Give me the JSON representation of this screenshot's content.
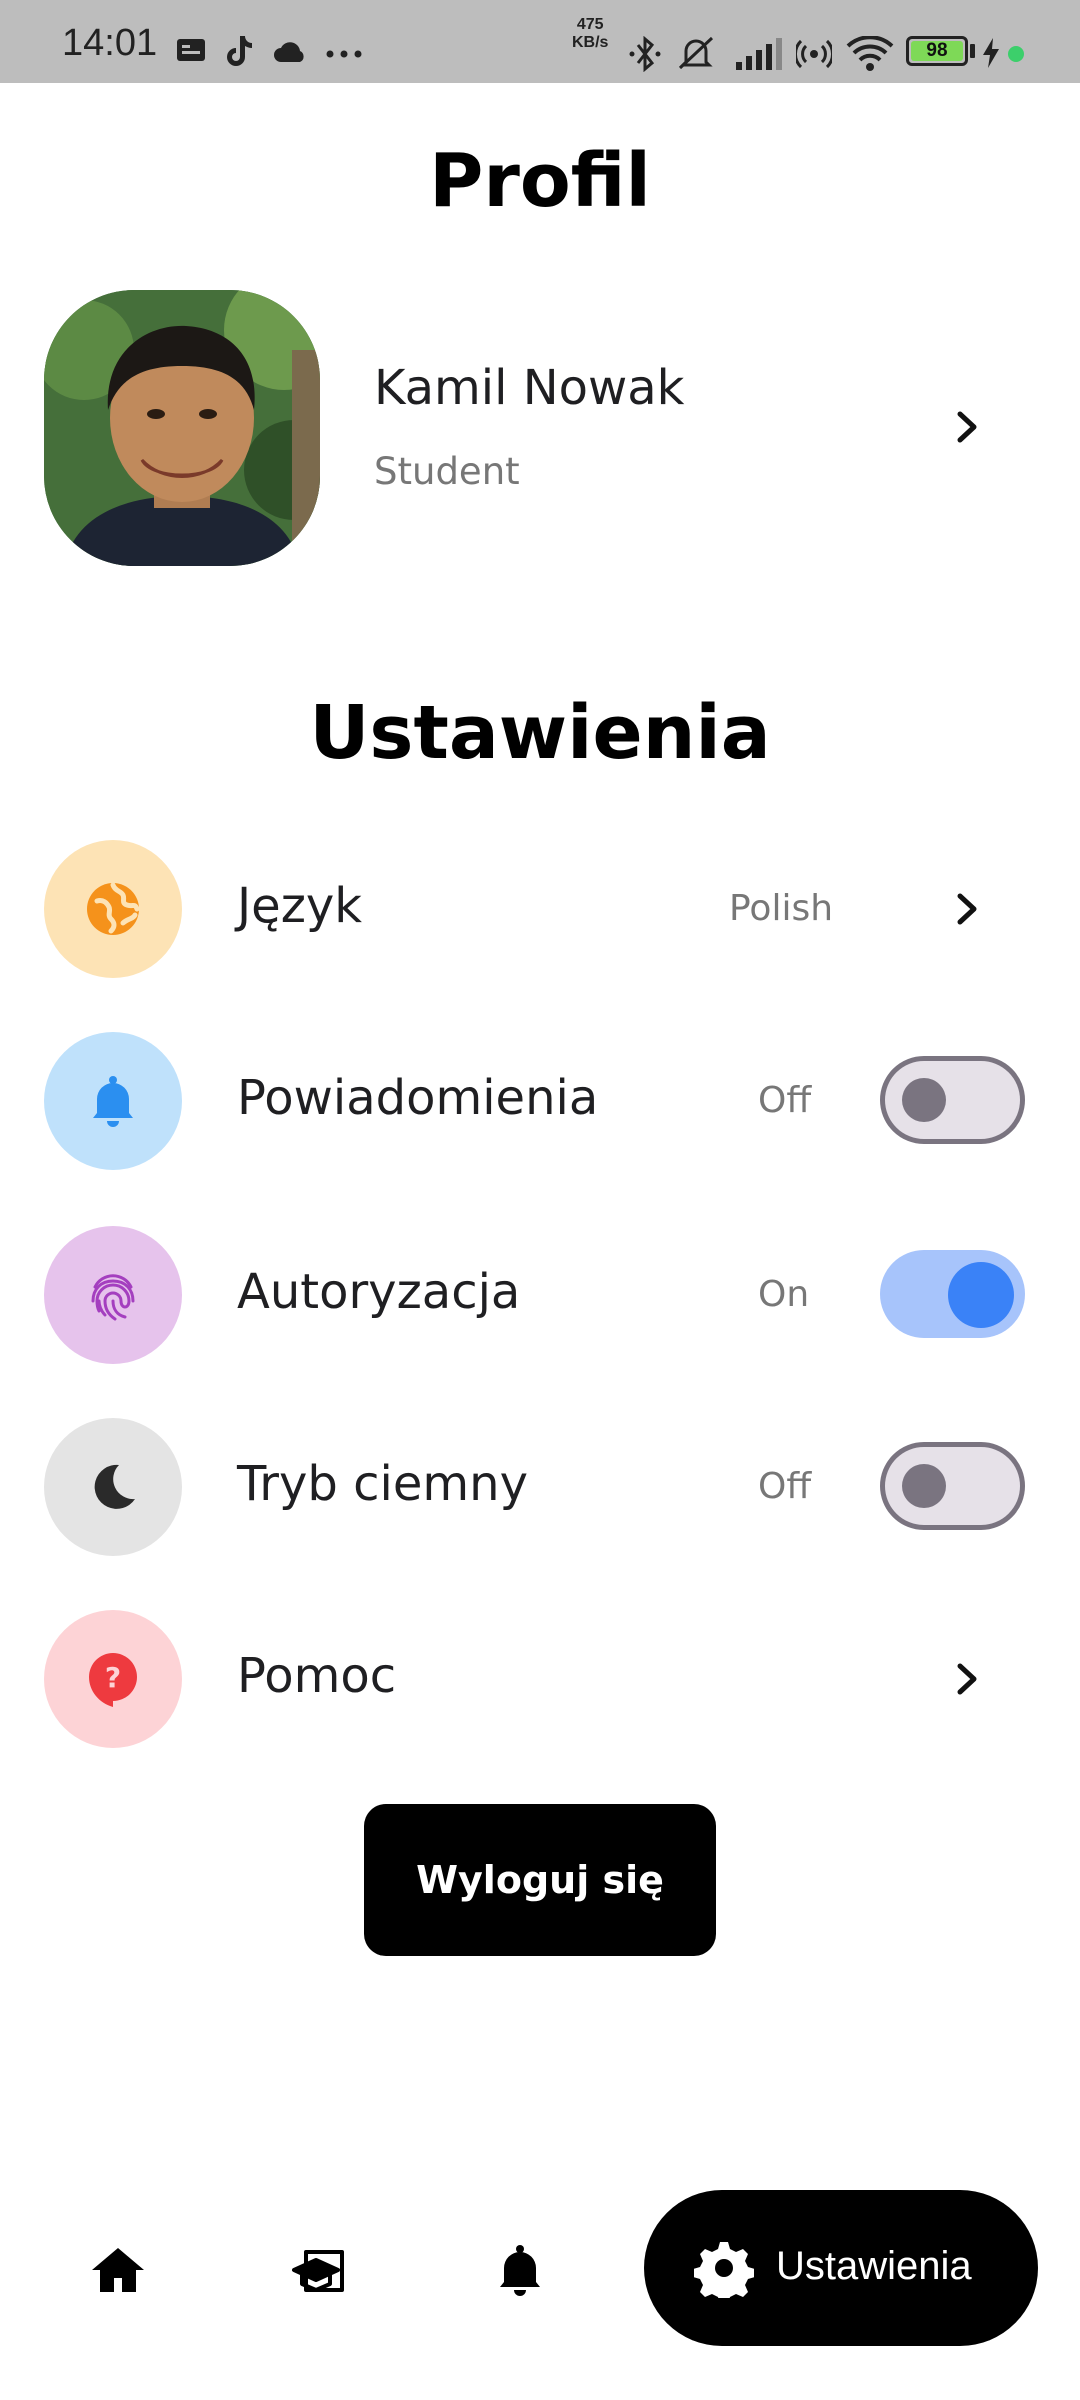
{
  "status_bar": {
    "time": "14:01",
    "net_speed_value": "475",
    "net_speed_unit": "KB/s",
    "battery": "98"
  },
  "header": {
    "title": "Profil"
  },
  "profile": {
    "name": "Kamil Nowak",
    "role": "Student",
    "avatar_icon": "user-photo"
  },
  "settings": {
    "title": "Ustawienia",
    "items": [
      {
        "label": "Język",
        "value": "Polish",
        "icon": "globe-icon",
        "color": "#fde3b5",
        "icon_color": "#f5921b",
        "control": "chevron"
      },
      {
        "label": "Powiadomienia",
        "value": "Off",
        "icon": "bell-icon",
        "color": "#bfe1fb",
        "icon_color": "#2b8ff0",
        "control": "toggle",
        "toggle_on": false
      },
      {
        "label": "Autoryzacja",
        "value": "On",
        "icon": "fingerprint-icon",
        "color": "#e6c3ec",
        "icon_color": "#a43fbf",
        "control": "toggle",
        "toggle_on": true
      },
      {
        "label": "Tryb ciemny",
        "value": "Off",
        "icon": "moon-icon",
        "color": "#e4e4e4",
        "icon_color": "#2a2a2a",
        "control": "toggle",
        "toggle_on": false
      },
      {
        "label": "Pomoc",
        "value": "",
        "icon": "help-icon",
        "color": "#fdd3d6",
        "icon_color": "#ee3a3f",
        "control": "chevron"
      }
    ]
  },
  "logout": {
    "label": "Wyloguj się"
  },
  "bottom_nav": {
    "items": [
      {
        "icon": "home-icon"
      },
      {
        "icon": "lesson-icon"
      },
      {
        "icon": "bell-icon"
      },
      {
        "icon": "gear-icon",
        "label": "Ustawienia",
        "active": true
      }
    ]
  }
}
